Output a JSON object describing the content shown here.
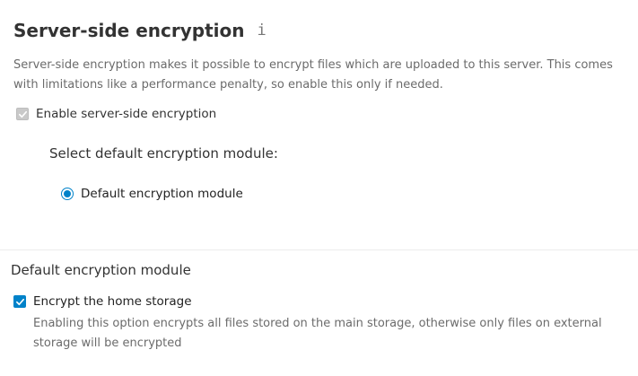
{
  "server_side": {
    "title": "Server-side encryption",
    "info_icon": "info-icon",
    "description": "Server-side encryption makes it possible to encrypt files which are uploaded to this server. This comes with limitations like a performance penalty, so enable this only if needed.",
    "enable_label": "Enable server-side encryption",
    "enable_checked": true,
    "enable_disabled": true,
    "module_heading": "Select default encryption module:",
    "module_option": "Default encryption module",
    "module_selected": true
  },
  "default_module": {
    "title": "Default encryption module",
    "home_label": "Encrypt the home storage",
    "home_checked": true,
    "home_help": "Enabling this option encrypts all files stored on the main storage, otherwise only files on external storage will be encrypted"
  },
  "colors": {
    "accent": "#0082c9",
    "muted_text": "#6b6b6b",
    "disabled_box": "#c9c9c9"
  }
}
